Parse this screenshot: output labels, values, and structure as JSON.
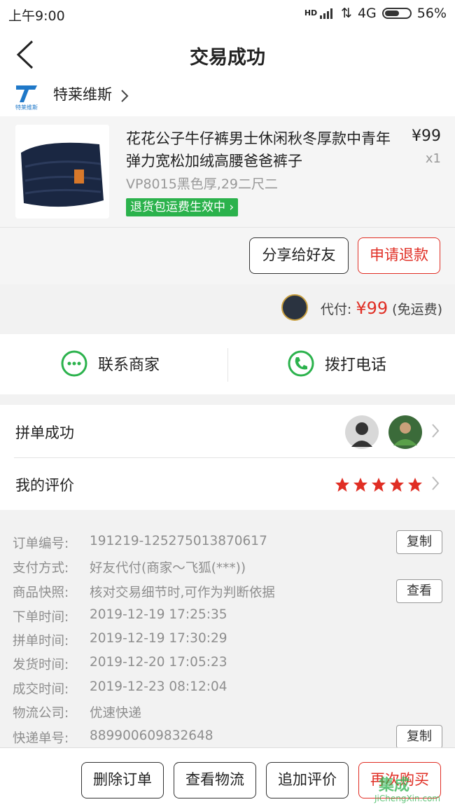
{
  "status": {
    "time": "上午9:00",
    "signal_label": "HD",
    "network": "4G",
    "battery": "56%"
  },
  "nav": {
    "title": "交易成功",
    "back_icon": "back-arrow-icon"
  },
  "shop": {
    "name": "特莱维斯",
    "logo_text": "特莱维斯"
  },
  "product": {
    "title": "花花公子牛仔裤男士休闲秋冬厚款中青年弹力宽松加绒高腰爸爸裤子",
    "price": "¥99",
    "qty": "x1",
    "sku": "VP8015黑色厚,29二尺二",
    "tag": "退货包运费生效中",
    "share_btn": "分享给好友",
    "refund_btn": "申请退款"
  },
  "payment": {
    "label": "代付:",
    "amount": "¥99",
    "note": "(免运费)"
  },
  "contact": {
    "merchant": "联系商家",
    "phone": "拨打电话"
  },
  "group": {
    "label": "拼单成功"
  },
  "review": {
    "label": "我的评价",
    "stars": 5
  },
  "details": [
    {
      "k": "订单编号:",
      "v": "191219-125275013870617",
      "btn": "复制"
    },
    {
      "k": "支付方式:",
      "v": "好友代付(商家～飞狐(***))"
    },
    {
      "k": "商品快照:",
      "v": "核对交易细节时,可作为判断依据",
      "btn": "查看"
    },
    {
      "k": "下单时间:",
      "v": "2019-12-19 17:25:35"
    },
    {
      "k": "拼单时间:",
      "v": "2019-12-19 17:30:29"
    },
    {
      "k": "发货时间:",
      "v": "2019-12-20 17:05:23"
    },
    {
      "k": "成交时间:",
      "v": "2019-12-23 08:12:04"
    },
    {
      "k": "物流公司:",
      "v": "优速快递"
    },
    {
      "k": "快递单号:",
      "v": "889900609832648",
      "btn": "复制"
    }
  ],
  "bottom": {
    "delete": "删除订单",
    "logistics": "查看物流",
    "add_review": "追加评价",
    "rebuy": "再次购买"
  },
  "watermark": {
    "cn": "集成",
    "en": "JiChengXin.com"
  },
  "colors": {
    "accent": "#e02e24",
    "green": "#2bb24c"
  }
}
